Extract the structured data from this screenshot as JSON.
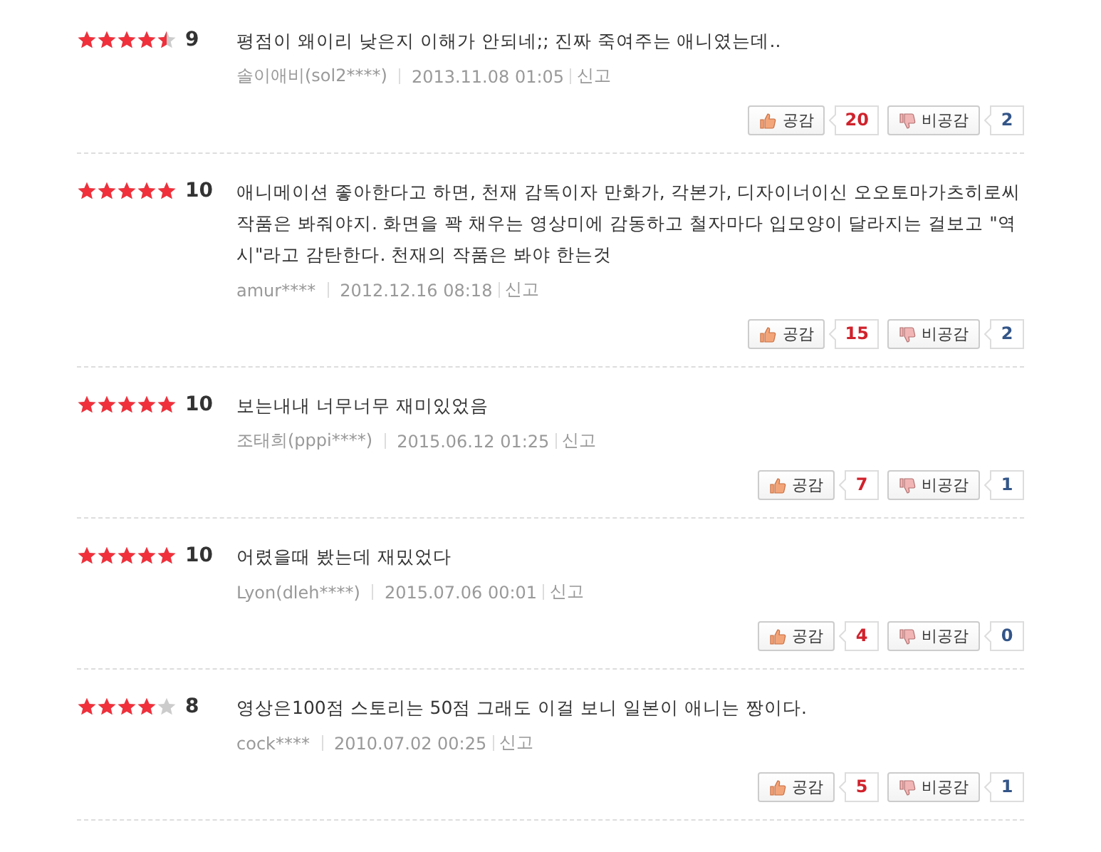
{
  "reviews": [
    {
      "stars": 4.5,
      "score": "9",
      "text": "평점이 왜이리 낮은지 이해가 안되네;; 진짜 죽여주는 애니였는데..",
      "author": "솔이애비(sol2****)",
      "date": "2013.11.08 01:05",
      "report": "신고",
      "like_label": "공감",
      "like_count": "20",
      "dislike_label": "비공감",
      "dislike_count": "2"
    },
    {
      "stars": 5,
      "score": "10",
      "text": "애니메이션 좋아한다고 하면, 천재 감독이자 만화가, 각본가, 디자이너이신 오오토마가츠히로씨 작품은 봐줘야지. 화면을 꽉 채우는 영상미에 감동하고 철자마다 입모양이 달라지는 걸보고 \"역시\"라고 감탄한다. 천재의 작품은 봐야 한는것",
      "author": "amur****",
      "date": "2012.12.16 08:18",
      "report": "신고",
      "like_label": "공감",
      "like_count": "15",
      "dislike_label": "비공감",
      "dislike_count": "2"
    },
    {
      "stars": 5,
      "score": "10",
      "text": "보는내내 너무너무 재미있었음",
      "author": "조태희(pppi****)",
      "date": "2015.06.12 01:25",
      "report": "신고",
      "like_label": "공감",
      "like_count": "7",
      "dislike_label": "비공감",
      "dislike_count": "1"
    },
    {
      "stars": 5,
      "score": "10",
      "text": "어렸을때 봤는데 재밌었다",
      "author": "Lyon(dleh****)",
      "date": "2015.07.06 00:01",
      "report": "신고",
      "like_label": "공감",
      "like_count": "4",
      "dislike_label": "비공감",
      "dislike_count": "0"
    },
    {
      "stars": 4,
      "score": "8",
      "text": "영상은100점 스토리는 50점 그래도 이걸 보니 일본이 애니는 짱이다.",
      "author": "cock****",
      "date": "2010.07.02 00:25",
      "report": "신고",
      "like_label": "공감",
      "like_count": "5",
      "dislike_label": "비공감",
      "dislike_count": "1"
    }
  ]
}
